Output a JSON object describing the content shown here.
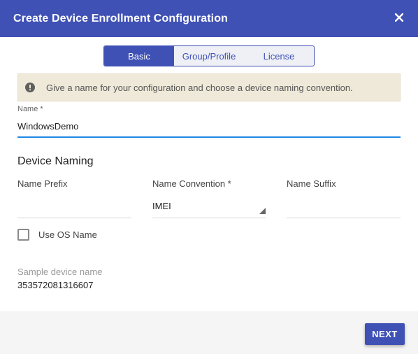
{
  "dialog": {
    "title": "Create Device Enrollment Configuration",
    "close_icon": "close-icon"
  },
  "tabs": [
    {
      "label": "Basic",
      "active": true
    },
    {
      "label": "Group/Profile",
      "active": false
    },
    {
      "label": "License",
      "active": false
    }
  ],
  "notice": {
    "icon": "exclamation-circle-icon",
    "text": "Give a name for your configuration and choose a device naming convention."
  },
  "name_field": {
    "label": "Name *",
    "value": "WindowsDemo"
  },
  "device_naming": {
    "title": "Device Naming",
    "prefix": {
      "label": "Name Prefix",
      "value": ""
    },
    "convention": {
      "label": "Name Convention *",
      "value": "IMEI"
    },
    "suffix": {
      "label": "Name Suffix",
      "value": ""
    },
    "use_os_name": {
      "label": "Use OS Name",
      "checked": false
    }
  },
  "sample": {
    "label": "Sample device name",
    "value": "353572081316607"
  },
  "footer": {
    "next_label": "NEXT"
  },
  "colors": {
    "primary": "#3f51b5",
    "accent_underline": "#1e88e5",
    "notice_bg": "#efe9d9"
  }
}
